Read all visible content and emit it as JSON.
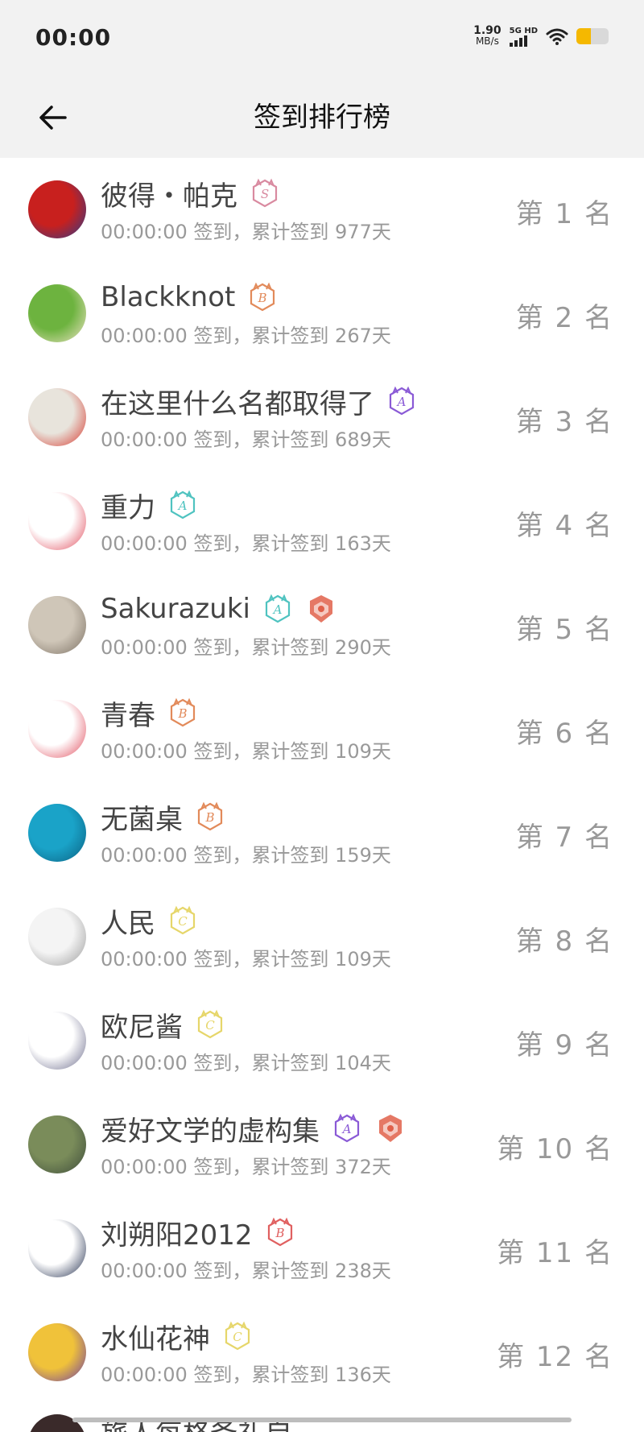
{
  "status_bar": {
    "time": "00:00",
    "net_speed_value": "1.90",
    "net_speed_unit": "MB/s",
    "signal_label": "5G HD",
    "battery_level": 0.45,
    "battery_color": "#f5b800"
  },
  "header": {
    "title": "签到排行榜",
    "back_icon": "arrow-left-icon"
  },
  "entries": [
    {
      "name": "彼得・帕克",
      "sub": "00:00:00 签到，累计签到 977天",
      "rank": "第 1 名",
      "badges": [
        {
          "letter": "S",
          "color": "#d98aa0"
        }
      ],
      "avatar_colors": [
        "#c8201e",
        "#2a3c8c"
      ]
    },
    {
      "name": "Blackknot",
      "sub": "00:00:00 签到，累计签到 267天",
      "rank": "第 2 名",
      "badges": [
        {
          "letter": "B",
          "color": "#e28a5a"
        }
      ],
      "avatar_colors": [
        "#6db33f",
        "#f1e4c8"
      ]
    },
    {
      "name": "在这里什么名都取得了",
      "sub": "00:00:00 签到，累计签到 689天",
      "rank": "第 3 名",
      "badges": [
        {
          "letter": "A",
          "color": "#8a5ad6"
        }
      ],
      "avatar_colors": [
        "#e8e4dc",
        "#d6352b"
      ]
    },
    {
      "name": "重力",
      "sub": "00:00:00 签到，累计签到 163天",
      "rank": "第 4 名",
      "badges": [
        {
          "letter": "A",
          "color": "#4fc3c0"
        }
      ],
      "avatar_colors": [
        "#ffffff",
        "#e04a5a"
      ]
    },
    {
      "name": "Sakurazuki",
      "sub": "00:00:00 签到，累计签到 290天",
      "rank": "第 5 名",
      "badges": [
        {
          "letter": "A",
          "color": "#4fc3c0"
        },
        {
          "letter": "crest",
          "color": "#e0604a"
        }
      ],
      "avatar_colors": [
        "#cfc6b8",
        "#7a6f62"
      ]
    },
    {
      "name": "青春",
      "sub": "00:00:00 签到，累计签到 109天",
      "rank": "第 6 名",
      "badges": [
        {
          "letter": "B",
          "color": "#e28a5a"
        }
      ],
      "avatar_colors": [
        "#ffffff",
        "#e04a5a"
      ]
    },
    {
      "name": "无菌桌",
      "sub": "00:00:00 签到，累计签到 159天",
      "rank": "第 7 名",
      "badges": [
        {
          "letter": "B",
          "color": "#e28a5a"
        }
      ],
      "avatar_colors": [
        "#1aa3c8",
        "#0b5f80"
      ]
    },
    {
      "name": "人民",
      "sub": "00:00:00 签到，累计签到 109天",
      "rank": "第 8 名",
      "badges": [
        {
          "letter": "C",
          "color": "#e6d66a"
        }
      ],
      "avatar_colors": [
        "#f4f4f4",
        "#9a9a9a"
      ]
    },
    {
      "name": "欧尼酱",
      "sub": "00:00:00 签到，累计签到 104天",
      "rank": "第 9 名",
      "badges": [
        {
          "letter": "C",
          "color": "#e6d66a"
        }
      ],
      "avatar_colors": [
        "#ffffff",
        "#6a6a8a"
      ]
    },
    {
      "name": "爱好文学的虚构集",
      "sub": "00:00:00 签到，累计签到 372天",
      "rank": "第 10 名",
      "badges": [
        {
          "letter": "A",
          "color": "#8a5ad6"
        },
        {
          "letter": "crest",
          "color": "#e0604a"
        }
      ],
      "avatar_colors": [
        "#7a8c5a",
        "#3c4a3a"
      ]
    },
    {
      "name": "刘朔阳2012",
      "sub": "00:00:00 签到，累计签到 238天",
      "rank": "第 11 名",
      "badges": [
        {
          "letter": "B",
          "color": "#e06060"
        }
      ],
      "avatar_colors": [
        "#ffffff",
        "#1e2a4a"
      ]
    },
    {
      "name": "水仙花神",
      "sub": "00:00:00 签到，累计签到 136天",
      "rank": "第 12 名",
      "badges": [
        {
          "letter": "C",
          "color": "#e6d66a"
        }
      ],
      "avatar_colors": [
        "#f0c23a",
        "#6a3aa8"
      ]
    }
  ]
}
